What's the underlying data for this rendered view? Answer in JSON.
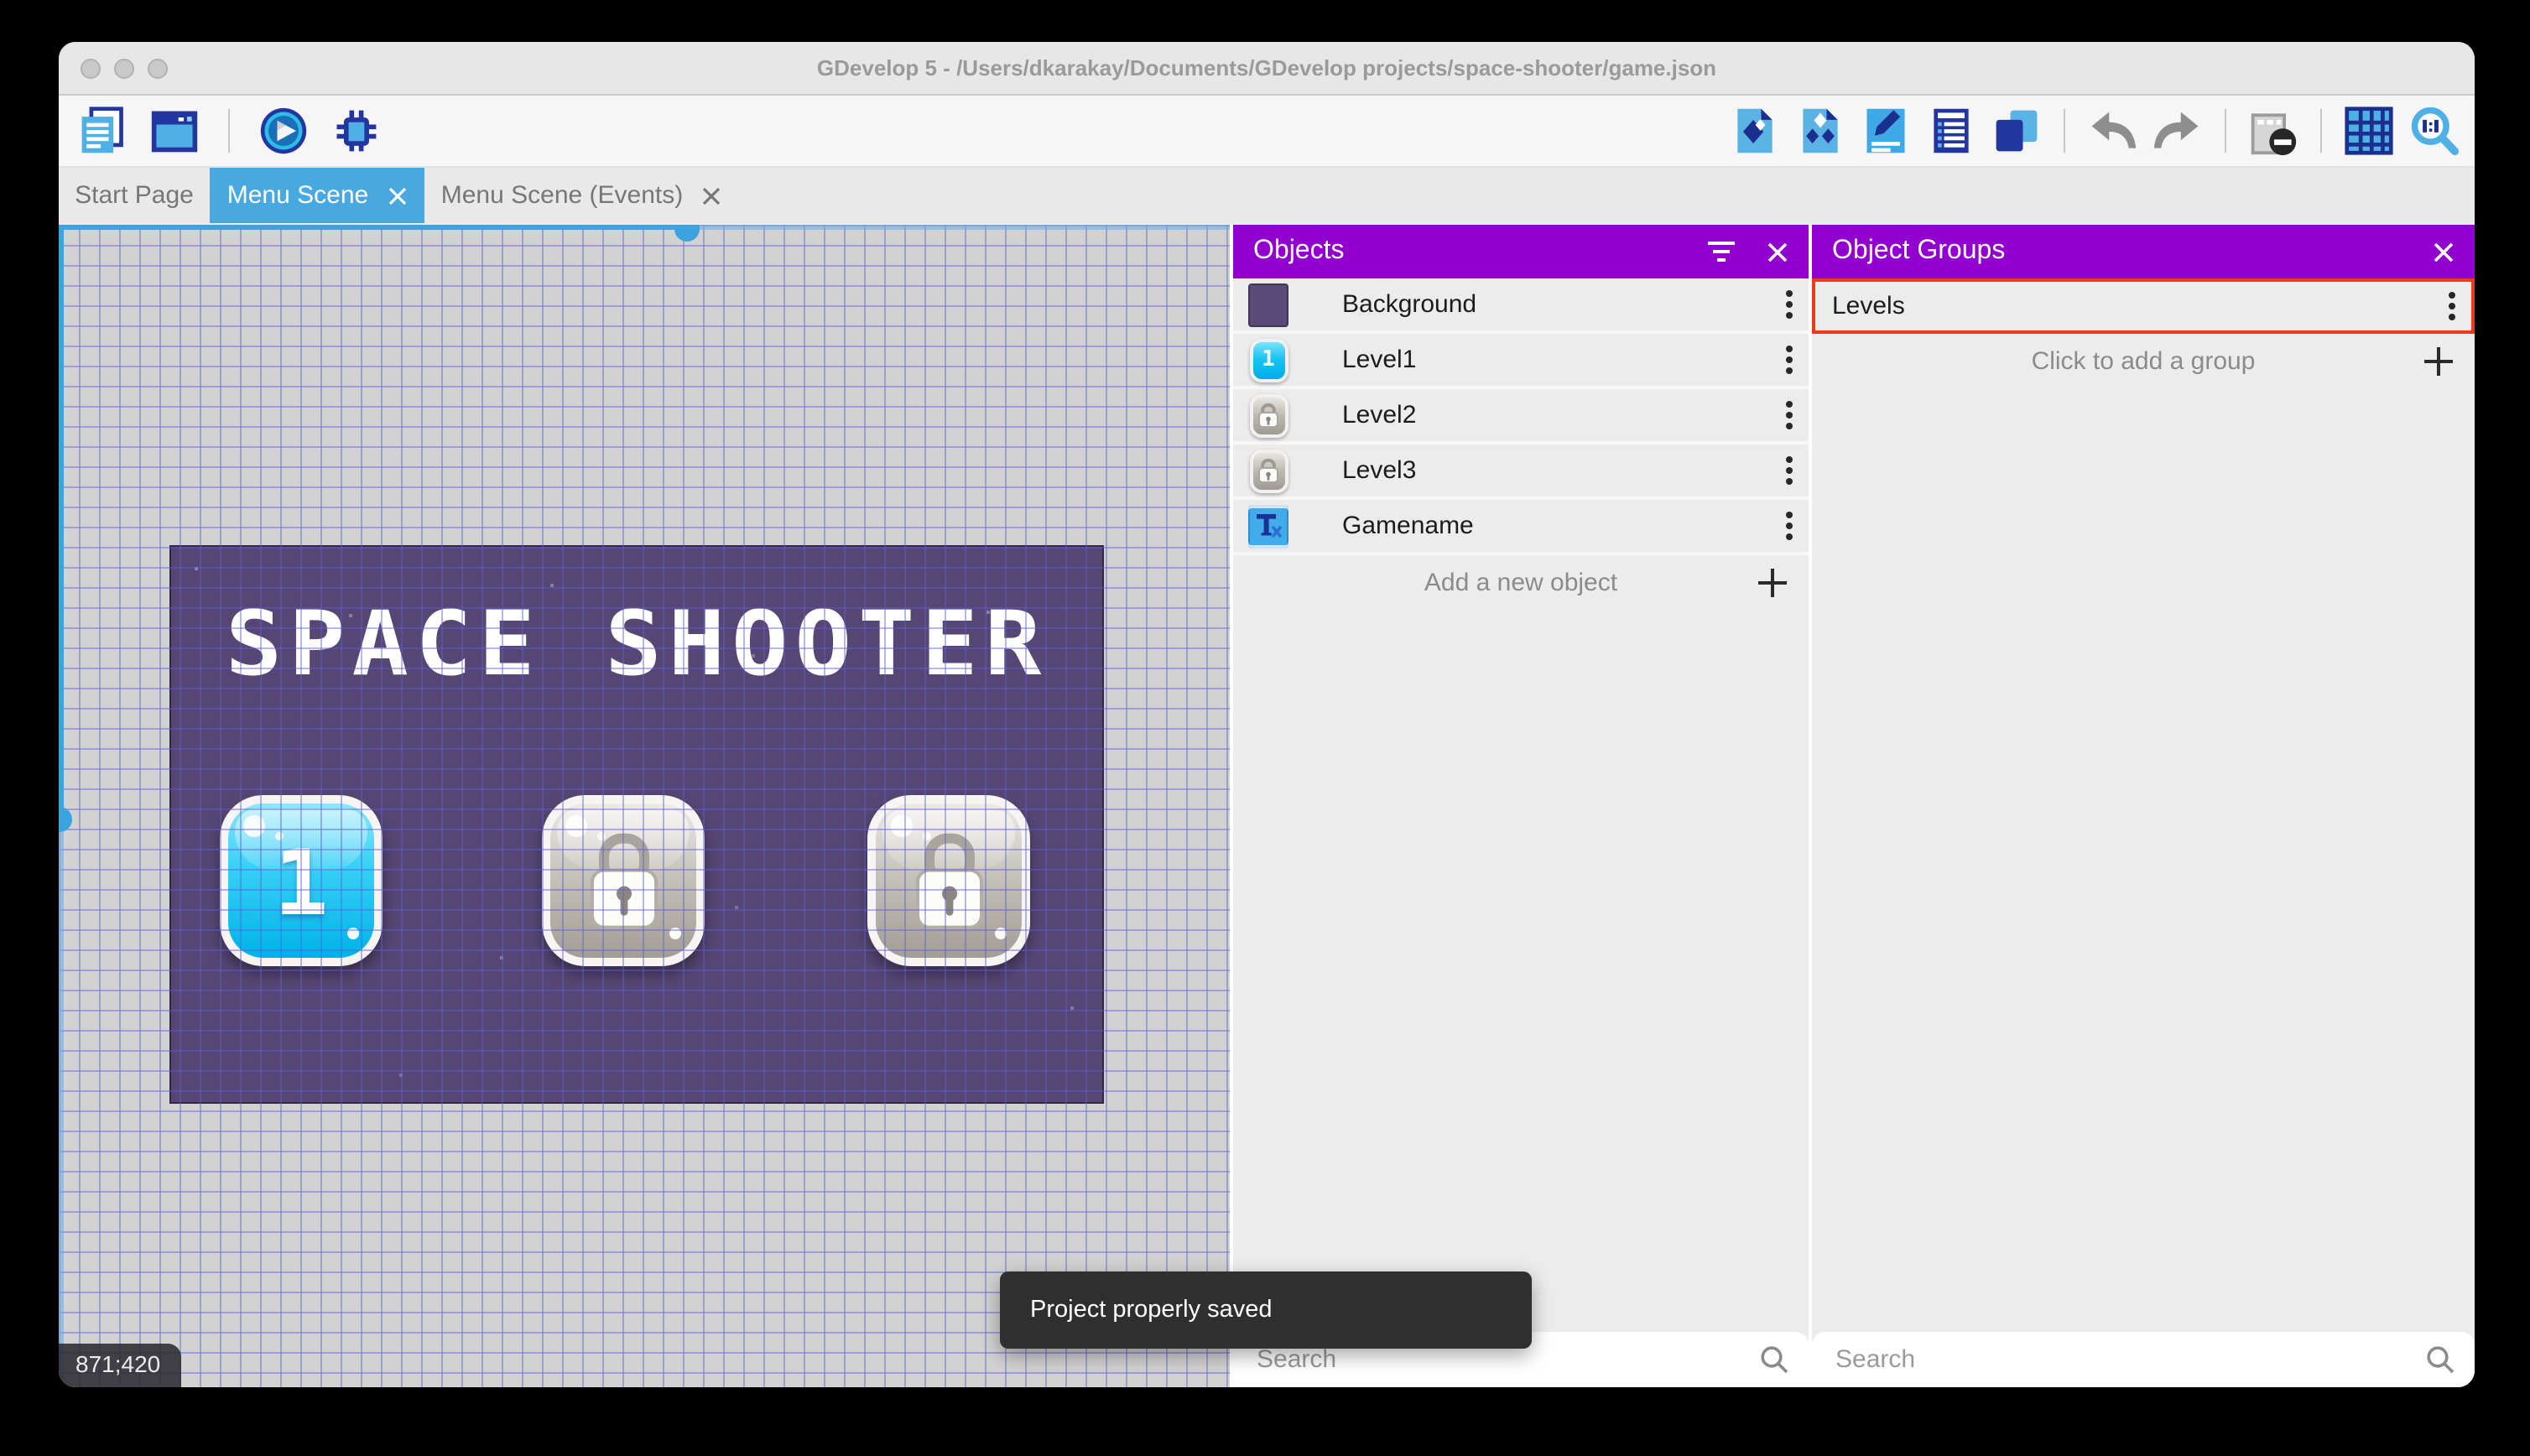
{
  "window": {
    "title": "GDevelop 5 - /Users/dkarakay/Documents/GDevelop projects/space-shooter/game.json",
    "traffic_lights": [
      "close",
      "minimize",
      "zoom"
    ]
  },
  "toolbar": {
    "left_icons": [
      "project-manager-icon",
      "scene-window-icon",
      "play-icon",
      "debug-icon"
    ],
    "right_icons": [
      "objects-editor-icon",
      "object-groups-icon",
      "properties-icon",
      "instances-list-icon",
      "layers-icon",
      "undo-icon",
      "redo-icon",
      "window-mask-icon",
      "grid-icon",
      "zoom-one-to-one-icon"
    ]
  },
  "tabs": [
    {
      "label": "Start Page",
      "active": false,
      "closable": false
    },
    {
      "label": "Menu Scene",
      "active": true,
      "closable": true
    },
    {
      "label": "Menu Scene (Events)",
      "active": false,
      "closable": true
    }
  ],
  "canvas": {
    "scene_title": "SPACE SHOOTER",
    "level_buttons": [
      {
        "label": "1",
        "state": "unlocked"
      },
      {
        "label": "",
        "state": "locked"
      },
      {
        "label": "",
        "state": "locked"
      }
    ],
    "coordinates": "871;420"
  },
  "objects_panel": {
    "title": "Objects",
    "header_icons": [
      "filter-icon",
      "close-icon"
    ],
    "items": [
      {
        "name": "Background",
        "icon": "background-thumbnail",
        "thumb_label": ""
      },
      {
        "name": "Level1",
        "icon": "level-one-button-thumbnail",
        "thumb_label": "1"
      },
      {
        "name": "Level2",
        "icon": "lock-button-thumbnail",
        "thumb_label": ""
      },
      {
        "name": "Level3",
        "icon": "lock-button-thumbnail",
        "thumb_label": ""
      },
      {
        "name": "Gamename",
        "icon": "text-object-thumbnail",
        "thumb_label": ""
      }
    ],
    "add_label": "Add a new object",
    "search_placeholder": "Search"
  },
  "object_groups_panel": {
    "title": "Object Groups",
    "header_icons": [
      "close-icon"
    ],
    "items": [
      {
        "name": "Levels",
        "highlighted": true
      }
    ],
    "add_label": "Click to add a group",
    "search_placeholder": "Search"
  },
  "toast": {
    "message": "Project properly saved"
  },
  "colors": {
    "accent_purple": "#9100ce",
    "accent_blue": "#47a9e0",
    "highlight_red": "#f2371f",
    "scene_background": "#564673",
    "toast_background": "#2f2f2f"
  }
}
